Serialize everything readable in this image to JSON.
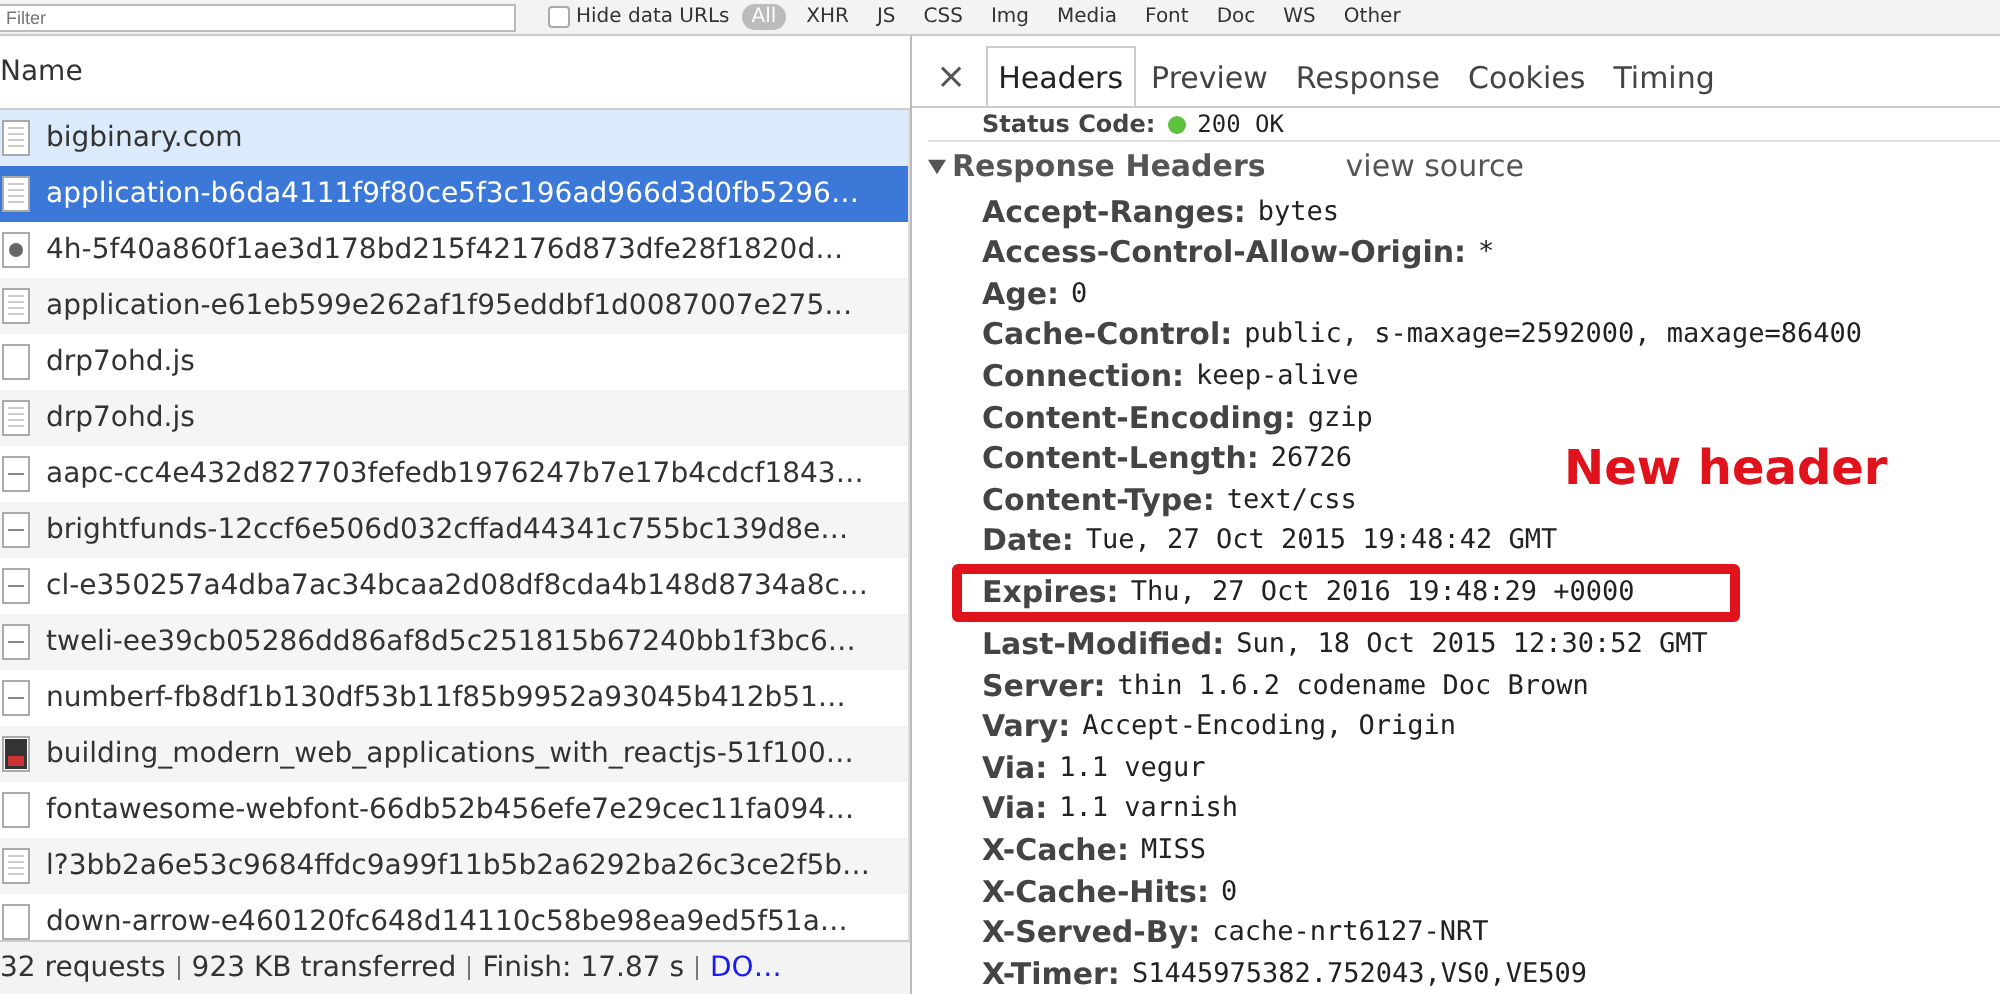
{
  "toolbar": {
    "filter": {
      "placeholder": "Filter"
    },
    "hide_data_urls": {
      "label": "Hide data URLs",
      "checked": false
    },
    "all_button": "All",
    "types": [
      "XHR",
      "JS",
      "CSS",
      "Img",
      "Media",
      "Font",
      "Doc",
      "WS",
      "Other"
    ]
  },
  "requests": {
    "column": "Name",
    "rows": [
      {
        "name": "bigbinary.com",
        "kind": "document",
        "selected": false,
        "hovered": true
      },
      {
        "name": "application-b6da4111f9f80ce5f3c196ad966d3d0fb5296…",
        "kind": "document",
        "selected": true,
        "hovered": false
      },
      {
        "name": "4h-5f40a860f1ae3d178bd215f42176d873dfe28f1820d…",
        "kind": "image",
        "selected": false,
        "hovered": false
      },
      {
        "name": "application-e61eb599e262af1f95eddbf1d0087007e275…",
        "kind": "document",
        "selected": false,
        "hovered": false
      },
      {
        "name": "drp7ohd.js",
        "kind": "blank",
        "selected": false,
        "hovered": false
      },
      {
        "name": "drp7ohd.js",
        "kind": "document",
        "selected": false,
        "hovered": false
      },
      {
        "name": "aapc-cc4e432d827703fefedb1976247b7e17b4cdcf1843…",
        "kind": "thumbnail",
        "selected": false,
        "hovered": false
      },
      {
        "name": "brightfunds-12ccf6e506d032cffad44341c755bc139d8e…",
        "kind": "thumbnail",
        "selected": false,
        "hovered": false
      },
      {
        "name": "cl-e350257a4dba7ac34bcaa2d08df8cda4b148d8734a8c…",
        "kind": "thumbnail",
        "selected": false,
        "hovered": false
      },
      {
        "name": "tweli-ee39cb05286dd86af8d5c251815b67240bb1f3bc6…",
        "kind": "thumbnail",
        "selected": false,
        "hovered": false
      },
      {
        "name": "numberf-fb8df1b130df53b11f85b9952a93045b412b51…",
        "kind": "thumbnail",
        "selected": false,
        "hovered": false
      },
      {
        "name": "building_modern_web_applications_with_reactjs-51f100…",
        "kind": "photo",
        "selected": false,
        "hovered": false
      },
      {
        "name": "fontawesome-webfont-66db52b456efe7e29cec11fa094…",
        "kind": "blank",
        "selected": false,
        "hovered": false
      },
      {
        "name": "l?3bb2a6e53c9684ffdc9a99f11b5b2a6292ba26c3ce2f5b…",
        "kind": "document",
        "selected": false,
        "hovered": false
      },
      {
        "name": "down-arrow-e460120fc648d14110c58be98ea9ed5f51a…",
        "kind": "blank",
        "selected": false,
        "hovered": false
      }
    ],
    "summary": [
      "32 requests",
      "923 KB transferred",
      "Finish: 17.87 s"
    ],
    "summary_link": "DO…"
  },
  "details": {
    "close": "×",
    "tabs": [
      {
        "label": "Headers",
        "selected": true
      },
      {
        "label": "Preview",
        "selected": false
      },
      {
        "label": "Response",
        "selected": false
      },
      {
        "label": "Cookies",
        "selected": false
      },
      {
        "label": "Timing",
        "selected": false
      }
    ],
    "status": {
      "name": "Status Code:",
      "value": "200 OK",
      "color": "#5cc13b"
    },
    "section": {
      "title": "Response Headers",
      "expanded": true,
      "link": "view source"
    },
    "headers": [
      {
        "name": "Accept-Ranges:",
        "value": "bytes",
        "highlighted": false
      },
      {
        "name": "Access-Control-Allow-Origin:",
        "value": "*",
        "highlighted": false
      },
      {
        "name": "Age:",
        "value": "0",
        "highlighted": false
      },
      {
        "name": "Cache-Control:",
        "value": "public, s-maxage=2592000, maxage=86400",
        "highlighted": false
      },
      {
        "name": "Connection:",
        "value": "keep-alive",
        "highlighted": false
      },
      {
        "name": "Content-Encoding:",
        "value": "gzip",
        "highlighted": false
      },
      {
        "name": "Content-Length:",
        "value": "26726",
        "highlighted": false
      },
      {
        "name": "Content-Type:",
        "value": "text/css",
        "highlighted": false
      },
      {
        "name": "Date:",
        "value": "Tue, 27 Oct 2015 19:48:42 GMT",
        "highlighted": false
      },
      {
        "name": "Expires:",
        "value": "Thu, 27 Oct 2016 19:48:29 +0000",
        "highlighted": true
      },
      {
        "name": "Last-Modified:",
        "value": "Sun, 18 Oct 2015 12:30:52 GMT",
        "highlighted": false
      },
      {
        "name": "Server:",
        "value": "thin 1.6.2 codename Doc Brown",
        "highlighted": false
      },
      {
        "name": "Vary:",
        "value": "Accept-Encoding, Origin",
        "highlighted": false
      },
      {
        "name": "Via:",
        "value": "1.1 vegur",
        "highlighted": false
      },
      {
        "name": "Via:",
        "value": "1.1 varnish",
        "highlighted": false
      },
      {
        "name": "X-Cache:",
        "value": "MISS",
        "highlighted": false
      },
      {
        "name": "X-Cache-Hits:",
        "value": "0",
        "highlighted": false
      },
      {
        "name": "X-Served-By:",
        "value": "cache-nrt6127-NRT",
        "highlighted": false
      },
      {
        "name": "X-Timer:",
        "value": "S1445975382.752043,VS0,VE509",
        "highlighted": false
      }
    ],
    "annotation": "New header"
  }
}
